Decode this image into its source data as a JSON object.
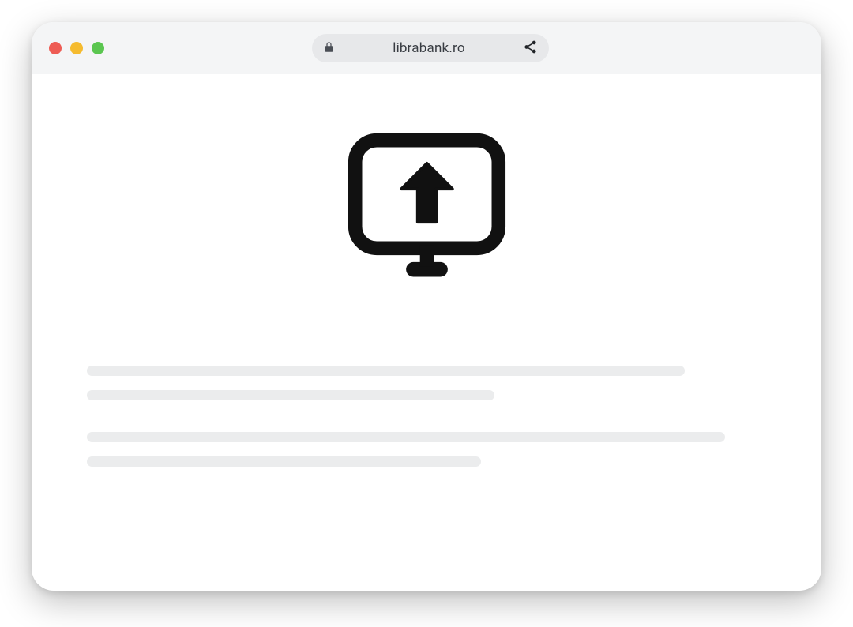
{
  "browser": {
    "domain": "librabank.ro",
    "traffic_lights": {
      "close_name": "close-window",
      "min_name": "minimize-window",
      "max_name": "maximize-window"
    },
    "lock_icon_name": "lock-icon",
    "share_icon_name": "share-icon"
  },
  "content": {
    "hero_icon_name": "monitor-upload-icon",
    "placeholder_lines": [
      {
        "width_pct": 88
      },
      {
        "width_pct": 60
      },
      {
        "width_pct": 94
      },
      {
        "width_pct": 58
      }
    ]
  }
}
